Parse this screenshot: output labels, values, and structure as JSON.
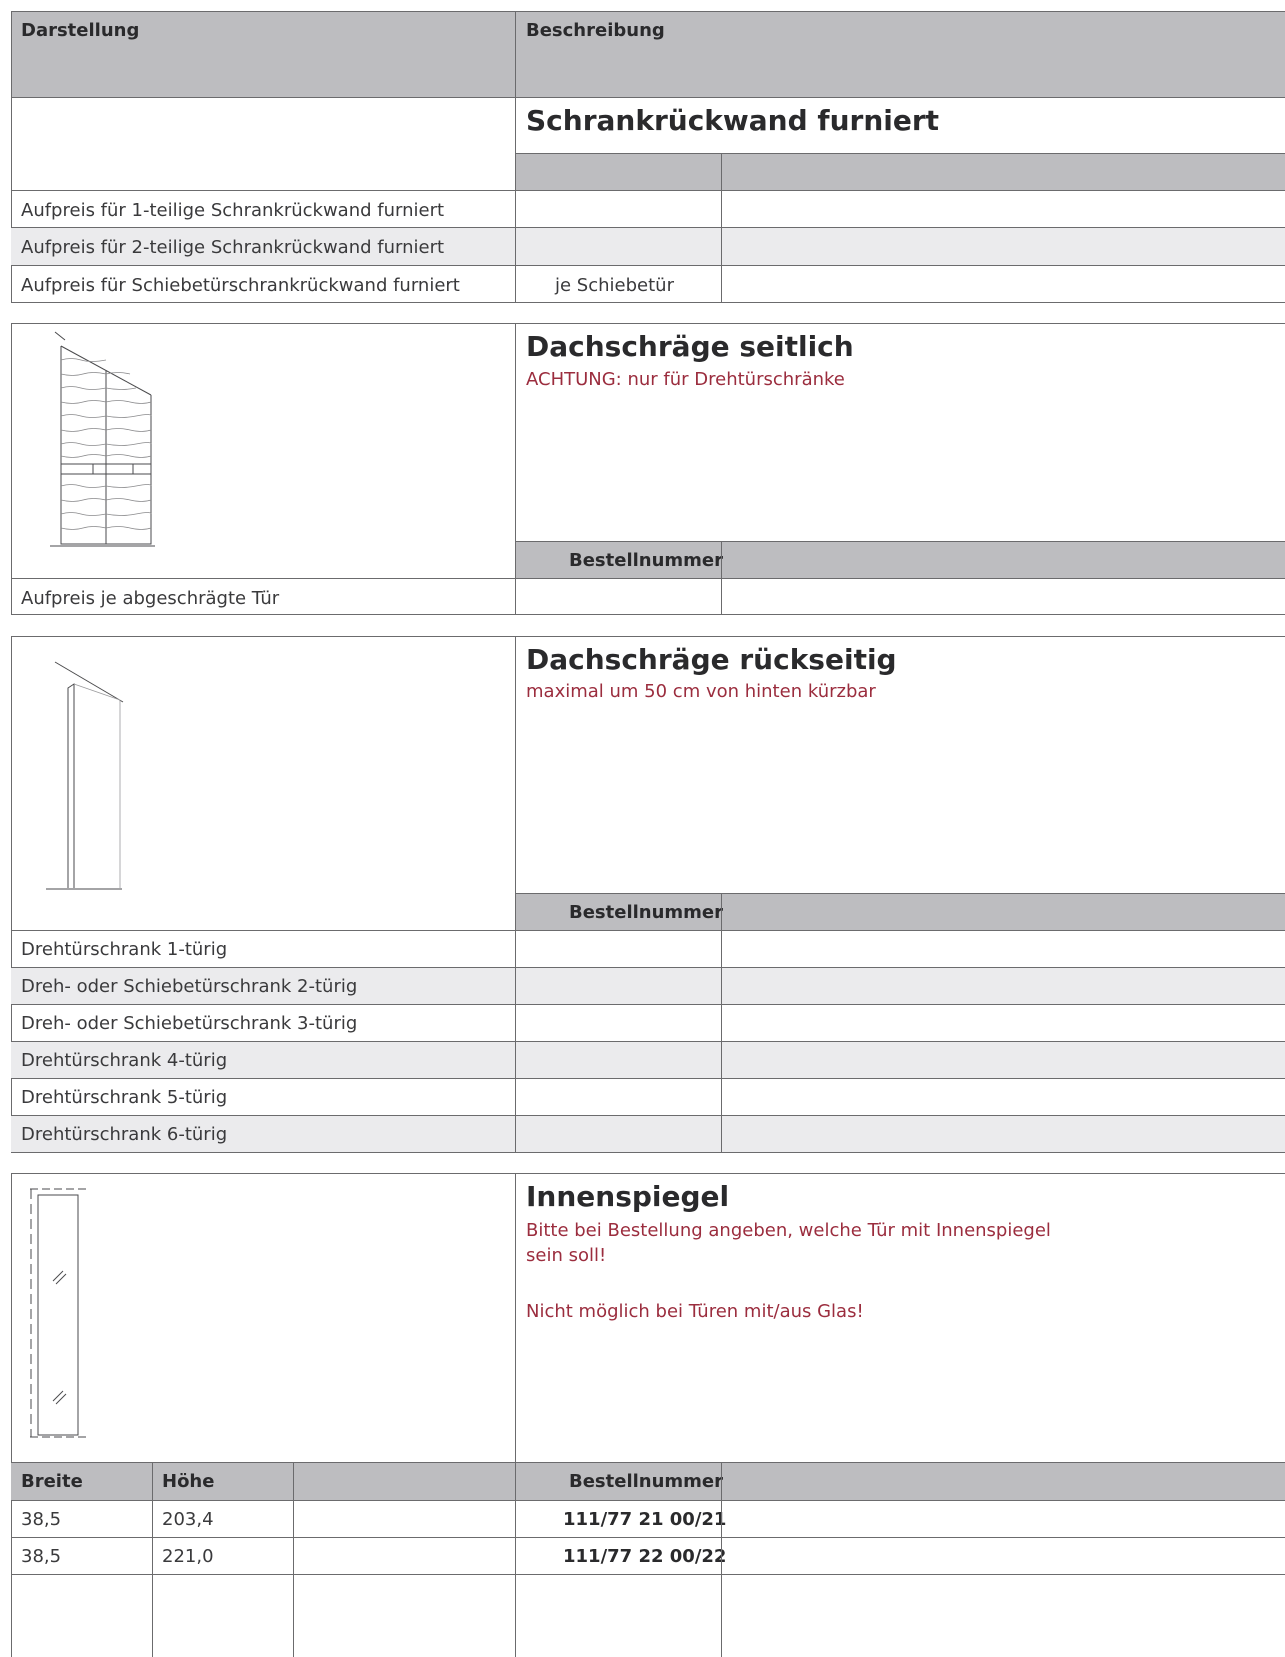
{
  "header": {
    "col_left": "Darstellung",
    "col_right": "Beschreibung"
  },
  "section1": {
    "title": "Schrankrückwand furniert",
    "rows": [
      {
        "label": "Aufpreis für 1-teilige Schrankrückwand furniert",
        "mid": ""
      },
      {
        "label": "Aufpreis für 2-teilige Schrankrückwand furniert",
        "mid": ""
      },
      {
        "label": "Aufpreis für Schiebetürschrankrückwand furniert",
        "mid": "je Schiebetür"
      }
    ]
  },
  "section2": {
    "title": "Dachschräge seitlich",
    "note": "ACHTUNG: nur für Drehtürschränke",
    "order_header": "Bestellnummer",
    "rows": [
      {
        "label": "Aufpreis je abgeschrägte Tür"
      }
    ]
  },
  "section3": {
    "title": "Dachschräge rückseitig",
    "note": "maximal um 50 cm von hinten kürzbar",
    "order_header": "Bestellnummer",
    "rows": [
      {
        "label": "Drehtürschrank 1-türig"
      },
      {
        "label": "Dreh- oder Schiebetürschrank 2-türig"
      },
      {
        "label": "Dreh- oder Schiebetürschrank 3-türig"
      },
      {
        "label": "Drehtürschrank 4-türig"
      },
      {
        "label": "Drehtürschrank 5-türig"
      },
      {
        "label": "Drehtürschrank 6-türig"
      }
    ]
  },
  "section4": {
    "title": "Innenspiegel",
    "note_line1": "Bitte bei Bestellung angeben, welche Tür mit Innenspiegel",
    "note_line2": "sein soll!",
    "note2": "Nicht möglich bei Türen mit/aus Glas!",
    "columns": {
      "width": "Breite",
      "height": "Höhe",
      "order": "Bestellnummer"
    },
    "rows": [
      {
        "width": "38,5",
        "height": "203,4",
        "order": "111/77 21 00/21"
      },
      {
        "width": "38,5",
        "height": "221,0",
        "order": "111/77 22 00/22"
      }
    ]
  },
  "colors": {
    "header_bg": "#bdbdc0",
    "stripe_bg": "#ebebed",
    "note_red": "#9b2d3e"
  }
}
